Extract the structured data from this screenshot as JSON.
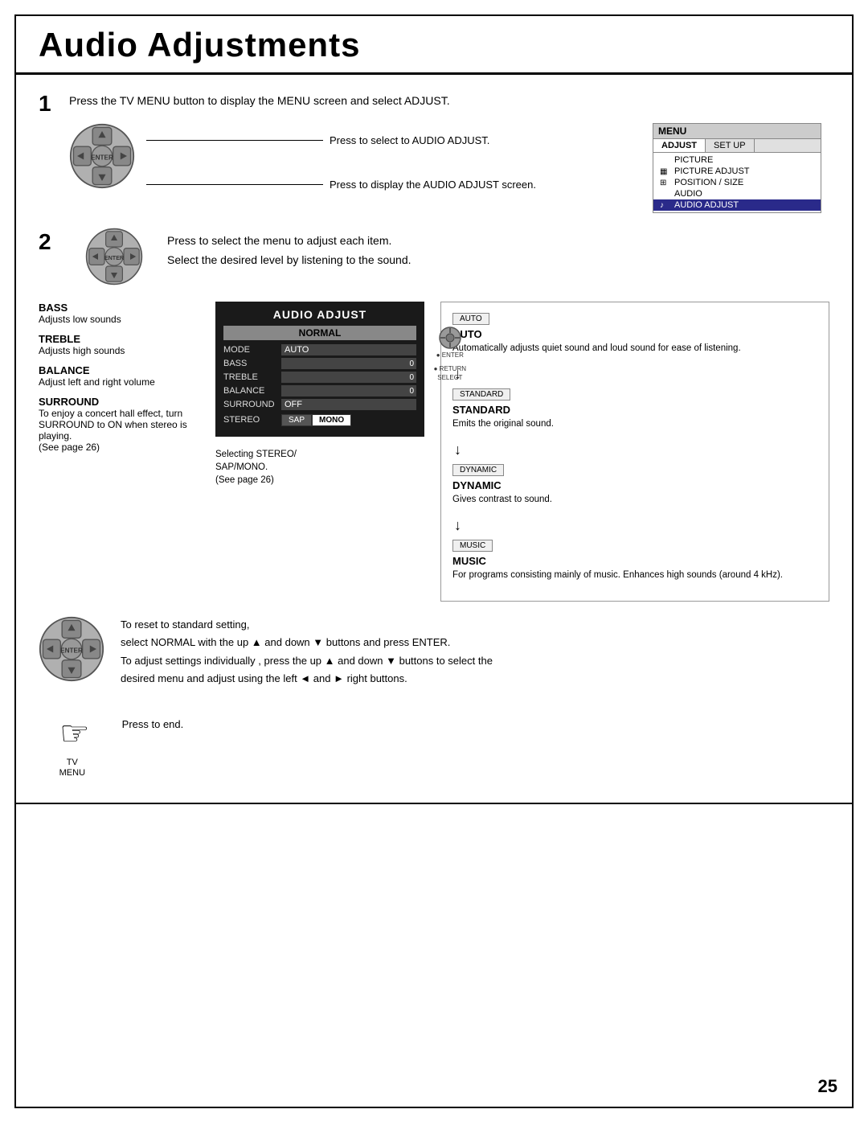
{
  "title": "Audio Adjustments",
  "step1": {
    "number": "1",
    "text": "Press the TV MENU button to display the MENU screen and select ADJUST.",
    "arrow1": "Press to select to AUDIO ADJUST.",
    "arrow2": "Press to display the AUDIO ADJUST screen."
  },
  "step2": {
    "number": "2",
    "text1": "Press to select the menu to adjust each item.",
    "text2": "Select the desired level by listening to the sound."
  },
  "menu": {
    "title": "MENU",
    "tab1": "ADJUST",
    "tab2": "SET UP",
    "items": [
      {
        "icon": "",
        "label": "PICTURE",
        "selected": false
      },
      {
        "icon": "▦",
        "label": "PICTURE ADJUST",
        "selected": false
      },
      {
        "icon": "⊞",
        "label": "POSITION / SIZE",
        "selected": false
      },
      {
        "icon": "",
        "label": "AUDIO",
        "selected": false
      },
      {
        "icon": "♪",
        "label": "AUDIO ADJUST",
        "selected": true
      }
    ]
  },
  "adjustItems": [
    {
      "label": "BASS",
      "desc": "Adjusts low sounds"
    },
    {
      "label": "TREBLE",
      "desc": "Adjusts high sounds"
    },
    {
      "label": "BALANCE",
      "desc": "Adjust left and right volume"
    },
    {
      "label": "SURROUND",
      "desc1": "To enjoy a concert hall effect, turn SURROUND to ON when stereo is playing.",
      "desc2": "(See page 26)"
    }
  ],
  "audioPanel": {
    "title": "AUDIO ADJUST",
    "normal": "NORMAL",
    "rows": [
      {
        "label": "MODE",
        "value": "AUTO",
        "type": "text"
      },
      {
        "label": "BASS",
        "value": "0",
        "type": "bar"
      },
      {
        "label": "TREBLE",
        "value": "0",
        "type": "bar"
      },
      {
        "label": "BALANCE",
        "value": "0",
        "type": "bar"
      },
      {
        "label": "SURROUND",
        "value": "OFF",
        "type": "text"
      },
      {
        "label": "STEREO",
        "value": "",
        "type": "stereo"
      }
    ],
    "stereoOptions": [
      "SAP",
      "MONO"
    ],
    "stereoActive": "MONO"
  },
  "panelNote": {
    "line1": "Selecting STEREO/",
    "line2": "SAP/MONO.",
    "line3": "(See page 26)"
  },
  "panelControls": {
    "enter": "ENTER",
    "return": "RETURN",
    "select": "SELECT"
  },
  "modes": [
    {
      "badge": "AUTO",
      "name": "AUTO",
      "desc": "Automatically adjusts quiet sound and loud sound for ease of listening."
    },
    {
      "badge": "STANDARD",
      "name": "STANDARD",
      "desc": "Emits the original sound."
    },
    {
      "badge": "DYNAMIC",
      "name": "DYNAMIC",
      "desc": "Gives contrast to sound."
    },
    {
      "badge": "MUSIC",
      "name": "MUSIC",
      "desc": "For programs consisting mainly of music. Enhances high sounds (around 4 kHz)."
    }
  ],
  "bottomText": {
    "line1": "To reset to standard setting,",
    "line2": "select NORMAL with the up ▲ and down ▼ buttons and press ENTER.",
    "line3": "To adjust settings individually , press the up ▲ and down ▼ buttons to select the",
    "line4": "desired menu and adjust using the left ◄ and ► right buttons."
  },
  "tvMenuLabel": "TV\nMENU",
  "pressEnd": "Press to end.",
  "pageNum": "25"
}
